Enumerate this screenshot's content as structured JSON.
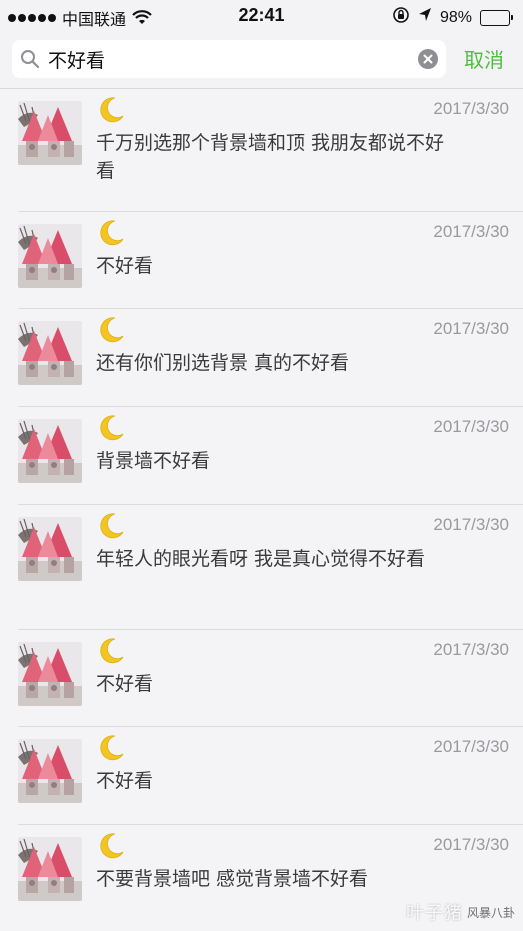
{
  "status_bar": {
    "carrier": "中国联通",
    "time": "22:41",
    "battery": "98%",
    "battery_level": 0.98
  },
  "search": {
    "query": "不好看",
    "cancel_label": "取消"
  },
  "results": [
    {
      "date": "2017/3/30",
      "text": "千万别选那个背景墙和顶 我朋友都说不好看"
    },
    {
      "date": "2017/3/30",
      "text": "不好看"
    },
    {
      "date": "2017/3/30",
      "text": "还有你们别选背景 真的不好看"
    },
    {
      "date": "2017/3/30",
      "text": "背景墙不好看"
    },
    {
      "date": "2017/3/30",
      "text": "年轻人的眼光看呀 我是真心觉得不好看"
    },
    {
      "date": "2017/3/30",
      "text": "不好看"
    },
    {
      "date": "2017/3/30",
      "text": "不好看"
    },
    {
      "date": "2017/3/30",
      "text": "不要背景墙吧 感觉背景墙不好看"
    }
  ],
  "watermark": {
    "main": "叶子猪",
    "sub": "风暴八卦"
  },
  "colors": {
    "accent": "#4cbf3d",
    "date": "#9a9a9e",
    "background": "#f4f4f6"
  }
}
